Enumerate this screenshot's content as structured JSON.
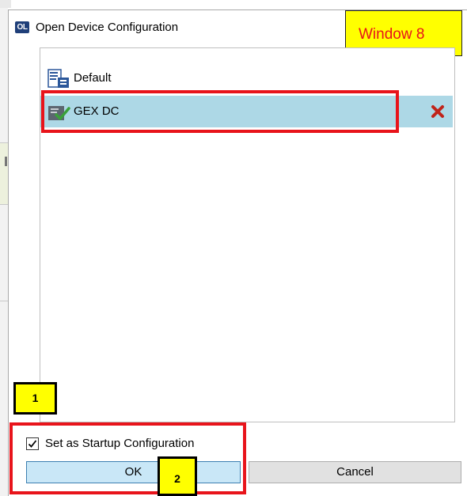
{
  "window": {
    "title": "Open Device Configuration",
    "app_icon_text": "OL"
  },
  "annotations": {
    "window_badge": "Window 8",
    "callout_1": "1",
    "callout_2": "2",
    "highlight_color": "#e8141b",
    "badge_color": "#ffff00"
  },
  "config_list": {
    "items": [
      {
        "label": "Default",
        "icon": "document-config-icon",
        "selected": false
      },
      {
        "label": "GEX DC",
        "icon": "config-check-icon",
        "selected": true,
        "delete_icon": "delete-x-icon"
      }
    ],
    "selected_color": "#add8e6"
  },
  "startup": {
    "checkbox_label": "Set as Startup Configuration",
    "checked": true
  },
  "buttons": {
    "ok": "OK",
    "cancel": "Cancel"
  }
}
